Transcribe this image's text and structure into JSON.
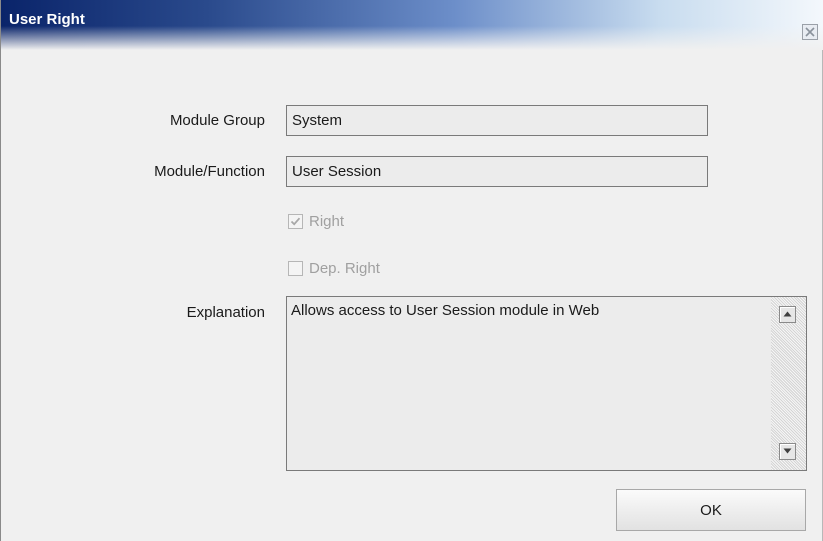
{
  "window": {
    "title": "User Right"
  },
  "form": {
    "module_group": {
      "label": "Module Group",
      "value": "System"
    },
    "module_function": {
      "label": "Module/Function",
      "value": "User Session"
    },
    "right": {
      "label": "Right",
      "checked": true,
      "enabled": false
    },
    "dep_right": {
      "label": "Dep. Right",
      "checked": false,
      "enabled": false
    },
    "explanation": {
      "label": "Explanation",
      "value": "Allows access to User Session module in Web"
    }
  },
  "buttons": {
    "ok_label": "OK"
  },
  "icons": {
    "close": "close-icon",
    "check": "checkmark-icon",
    "scroll_up": "scroll-up-arrow-icon",
    "scroll_down": "scroll-down-arrow-icon"
  },
  "colors": {
    "titlebar_start": "#0a246a",
    "titlebar_end": "#f4f8fc",
    "window_bg": "#f0f0f0",
    "disabled_text": "#a0a0a0"
  }
}
